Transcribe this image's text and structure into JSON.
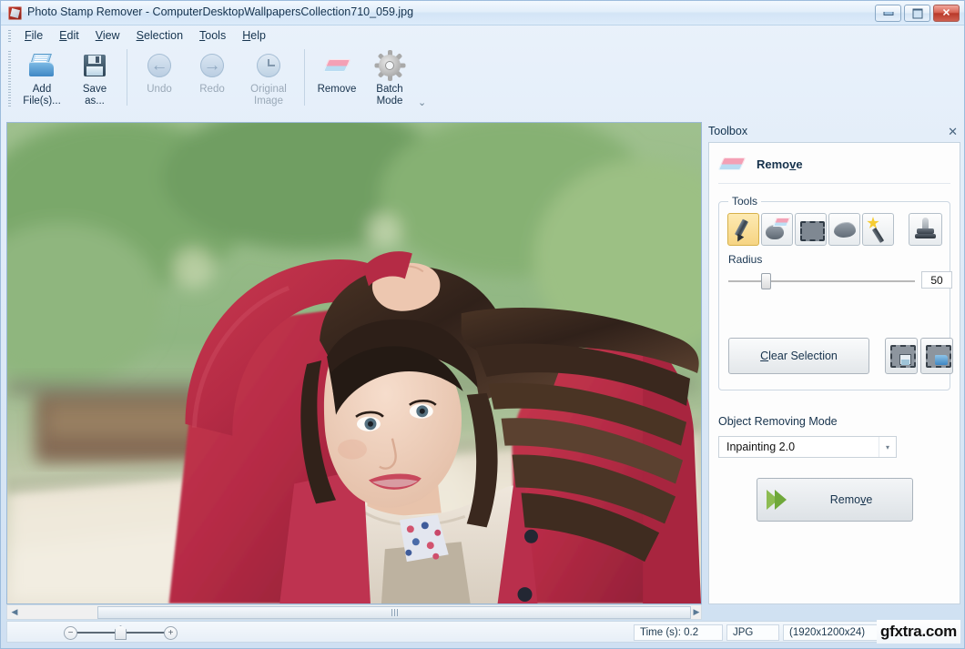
{
  "window": {
    "title": "Photo Stamp Remover - ComputerDesktopWallpapersCollection710_059.jpg",
    "app_icon": "stamp-remover-icon",
    "minimize_label": "Minimize",
    "maximize_label": "Maximize",
    "close_label": "✕"
  },
  "menu": {
    "items": [
      {
        "label": "File",
        "accel": "F"
      },
      {
        "label": "Edit",
        "accel": "E"
      },
      {
        "label": "View",
        "accel": "V"
      },
      {
        "label": "Selection",
        "accel": "S"
      },
      {
        "label": "Tools",
        "accel": "T"
      },
      {
        "label": "Help",
        "accel": "H"
      }
    ]
  },
  "toolbar": {
    "buttons": [
      {
        "label": "Add\nFile(s)...",
        "line1": "Add",
        "line2": "File(s)...",
        "icon": "open-folder-icon",
        "enabled": true
      },
      {
        "label": "Save as...",
        "line1": "Save",
        "line2": "as...",
        "icon": "floppy-disk-icon",
        "enabled": true
      },
      {
        "label": "Undo",
        "line1": "Undo",
        "line2": "",
        "icon": "undo-arrow-icon",
        "enabled": false
      },
      {
        "label": "Redo",
        "line1": "Redo",
        "line2": "",
        "icon": "redo-arrow-icon",
        "enabled": false
      },
      {
        "label": "Original Image",
        "line1": "Original",
        "line2": "Image",
        "icon": "clock-history-icon",
        "enabled": false
      },
      {
        "label": "Remove",
        "line1": "Remove",
        "line2": "",
        "icon": "eraser-icon",
        "enabled": true
      },
      {
        "label": "Batch Mode",
        "line1": "Batch",
        "line2": "Mode",
        "icon": "gear-icon",
        "enabled": true
      }
    ],
    "overflow_label": "⌄"
  },
  "toolbox": {
    "panel_title": "Toolbox",
    "close_icon": "✕",
    "header": {
      "icon": "eraser-icon",
      "label_pre": "Remo",
      "label_accel": "v",
      "label_post": "e"
    },
    "tools_group_label": "Tools",
    "tools": [
      {
        "name": "marker-tool",
        "selected": true
      },
      {
        "name": "eraser-tool",
        "selected": false
      },
      {
        "name": "rectangle-selection-tool",
        "selected": false
      },
      {
        "name": "lasso-tool",
        "selected": false
      },
      {
        "name": "magic-wand-tool",
        "selected": false
      }
    ],
    "stamp_tool": {
      "name": "clone-stamp-tool",
      "selected": false
    },
    "radius": {
      "label": "Radius",
      "value": "50",
      "min": 1,
      "max": 255,
      "percent": 18
    },
    "clear_selection": {
      "pre": "",
      "accel": "C",
      "post": "lear Selection"
    },
    "save_selection_icon": "save-selection-icon",
    "load_selection_icon": "load-selection-icon",
    "object_mode": {
      "label": "Object Removing Mode",
      "value": "Inpainting 2.0",
      "arrow": "▾",
      "options": [
        "Inpainting 2.0"
      ]
    },
    "remove_action": {
      "pre": "Remo",
      "accel": "v",
      "post": "e",
      "icon": "green-arrow-icon"
    }
  },
  "canvas": {
    "image_alt": "Woman in crimson coat holding her hair, blurred park background"
  },
  "scroll": {
    "left_arrow": "◀",
    "right_arrow": "▶",
    "thumb_grip": "|||"
  },
  "zoom_bar": {
    "zoom_out": "−",
    "zoom_in": "+",
    "fit_label": "fit-home-thumb"
  },
  "status": {
    "time": "Time (s): 0.2",
    "format": "JPG",
    "dimensions": "(1920x1200x24)",
    "watermark": "gfxtra.com"
  }
}
